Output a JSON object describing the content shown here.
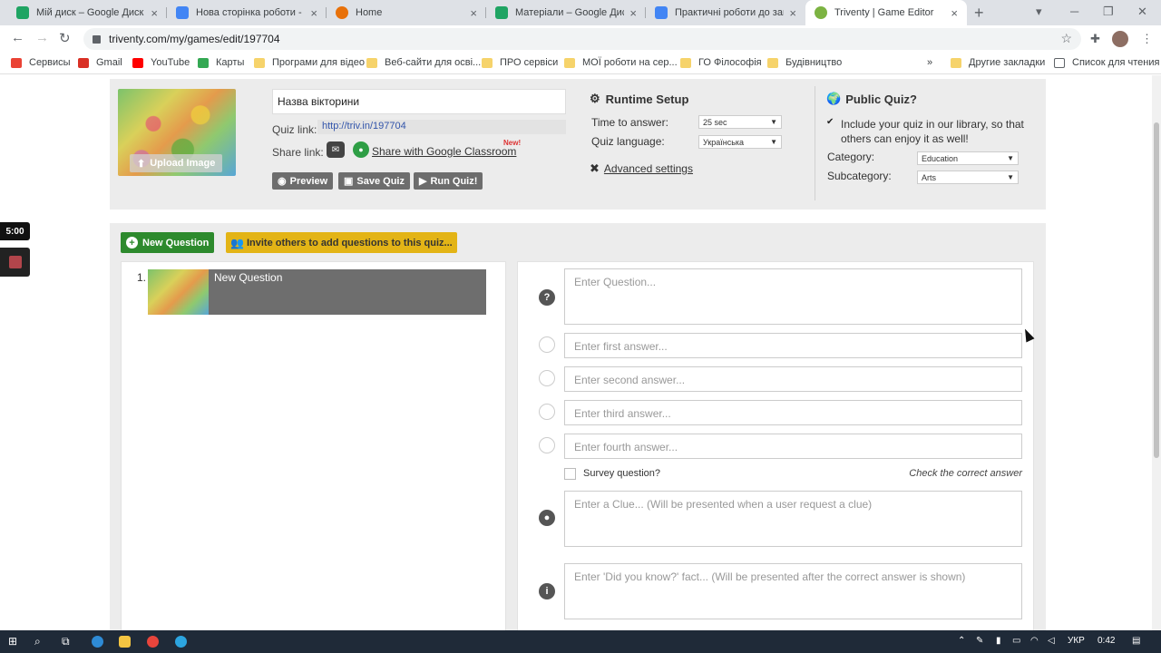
{
  "browser": {
    "tabs": [
      {
        "label": "Мій диск – Google Диск",
        "color": "#1fa463"
      },
      {
        "label": "Нова сторінка роботи - Go",
        "color": "#4285f4"
      },
      {
        "label": "Home",
        "color": "#e8710a"
      },
      {
        "label": "Матеріали – Google Диск",
        "color": "#1fa463"
      },
      {
        "label": "Практичні роботи до заня",
        "color": "#4285f4"
      },
      {
        "label": "Triventy | Game Editor",
        "color": "#7cb342"
      }
    ],
    "url": "triventy.com/my/games/edit/197704",
    "bookmarks": [
      {
        "label": "Сервисы",
        "color": "#ea4335"
      },
      {
        "label": "Gmail",
        "color": "#d93025"
      },
      {
        "label": "YouTube",
        "color": "#ff0000"
      },
      {
        "label": "Карты",
        "color": "#34a853"
      },
      {
        "label": "Програми для відео",
        "color": "#f6d36b"
      },
      {
        "label": "Веб-сайти для осві...",
        "color": "#f6d36b"
      },
      {
        "label": "ПРО сервіси",
        "color": "#f6d36b"
      },
      {
        "label": "МОЇ роботи на сер...",
        "color": "#f6d36b"
      },
      {
        "label": "ГО Філософія",
        "color": "#f6d36b"
      },
      {
        "label": "Будівництво",
        "color": "#f6d36b"
      }
    ],
    "bookmarks_more": "»",
    "other_bookmarks": "Другие закладки",
    "reading_list": "Список для чтения"
  },
  "quiz": {
    "title": "Назва вікторини",
    "cover_upload_label": "Upload Image",
    "quiz_link_label": "Quiz link:",
    "quiz_link": "http://triv.in/197704",
    "share_link_label": "Share link:",
    "share_classroom": "Share with Google Classroom",
    "new_badge": "New!",
    "buttons": {
      "preview": "Preview",
      "save": "Save Quiz",
      "run": "Run Quiz!"
    }
  },
  "runtime": {
    "heading": "Runtime Setup",
    "time_label": "Time to answer:",
    "time_value": "25 sec",
    "language_label": "Quiz language:",
    "language_value": "Українська",
    "advanced": "Advanced settings"
  },
  "public": {
    "heading": "Public Quiz?",
    "include_text": "Include your quiz in our library, so that others can enjoy it as well!",
    "include_checked": true,
    "category_label": "Category:",
    "category_value": "Education",
    "subcategory_label": "Subcategory:",
    "subcategory_value": "Arts"
  },
  "questions_panel": {
    "new_question": "New Question",
    "invite": "Invite others to add questions to this quiz...",
    "items": [
      {
        "number": "1.",
        "title": "New Question"
      }
    ]
  },
  "editor": {
    "question_placeholder": "Enter Question...",
    "answers": [
      "Enter first answer...",
      "Enter second answer...",
      "Enter third answer...",
      "Enter fourth answer..."
    ],
    "survey_label": "Survey question?",
    "check_correct": "Check the correct answer",
    "clue_placeholder": "Enter a Clue... (Will be presented when a user request a clue)",
    "fact_placeholder": "Enter 'Did you know?' fact... (Will be presented after the correct answer is shown)"
  },
  "overlay": {
    "timer": "5:00"
  },
  "taskbar": {
    "language": "УКР",
    "time": "0:42"
  }
}
